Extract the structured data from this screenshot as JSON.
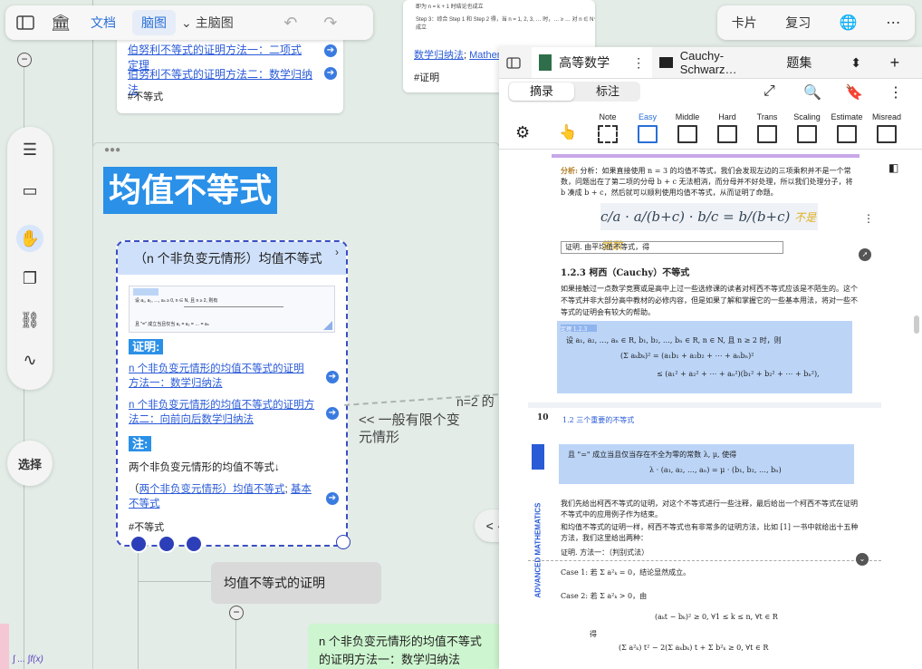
{
  "toolbar": {
    "tab_doc": "文档",
    "tab_mindmap": "脑图",
    "dropdown": "主脑图"
  },
  "topright": {
    "card": "卡片",
    "review": "复习"
  },
  "canvas": {
    "top_card": {
      "link1": "伯努利不等式的证明方法一：二项式定理",
      "link2": "伯努利不等式的证明方法二：数学归纳法",
      "tag": "#不等式"
    },
    "top_right_card": {
      "step": "Step 3：综合 Step 1 和 Step 2 得，当 n = 1, 2, 3, … 时，… ≥ … 对 n ∈ N⁺ 成立",
      "line0": "即为 n = k + 1 时结论也成立",
      "links": [
        "数学归纳法",
        "Mathem"
      ],
      "tag": "#证明"
    },
    "group_title": "均值不等式",
    "main_card": {
      "title": "（n 个非负变元情形）均值不等式",
      "thumb_caption": "设 a₁, a₂, …, aₙ ≥ 0, n ∈ N, 且 n ≥ 2, 则有",
      "thumb_note": "且 \"=\" 成立当且仅当 a₁ = a₂ = … = aₙ",
      "proof_label": "证明:",
      "link1": "n 个非负变元情形的均值不等式的证明方法一：数学归纳法",
      "link2": "n 个非负变元情形的均值不等式的证明方法二：向前向后数学归纳法",
      "note_label": "注:",
      "note_text": "两个非负变元情形的均值不等式↓",
      "link3a": "两个非负变元情形）均值不等式",
      "link3b": "基本不等式",
      "tag": "#不等式"
    },
    "edge_label1": "<< 一般有限个变元情形",
    "edge_label2": "n=2 的",
    "proof_node": "均值不等式的证明",
    "green_node": "n 个非负变元情形的均值不等式的证明方法一：数学归纳法",
    "nav": "< · >"
  },
  "left_tools": {
    "select": "选择"
  },
  "panel": {
    "tab1": "高等数学",
    "tab2": "Cauchy-Schwarz…",
    "tab3": "题集",
    "seg_excerpt": "摘录",
    "seg_annotate": "标注",
    "tools": [
      "Note",
      "Easy",
      "Middle",
      "Hard",
      "Trans",
      "Scaling",
      "Estimate",
      "Misread"
    ],
    "doc": {
      "analysis": "分析：如果直接使用 n = 3 的均值不等式，我们会发现左边的三项乘积并不是一个常数，问题出在了第二项的分母 b + c 无法相消，而分母并不好处理，所以我们处理分子，将 b 凑成 b + c，然后就可以顺利使用均值不等式，从而证明了命题。",
      "handwritten": "不是常数",
      "proof_line": "证明.  由平均值不等式，得",
      "section": "1.2.3  柯西（Cauchy）不等式",
      "intro": "如果接触过一点数学竞赛或是高中上过一些选修课的读者对柯西不等式应该是不陌生的。这个不等式并非大部分高中教材的必修内容，但是如果了解和掌握它的一些基本用法，将对一些不等式的证明会有较大的帮助。",
      "thm_label": "定理 1.2.3",
      "thm": "设 a₁, a₂, …, aₙ ∈ R, b₁, b₂, …, bₙ ∈ R, n ∈ N, 且 n ≥ 2 时，则",
      "page_no": "10",
      "page_head": "1.2  三个重要的不等式",
      "side_text": "ADVANCED MATHEMATICS",
      "cond": "且 \"=\" 成立当且仅当存在不全为零的常数 λ, μ, 使得",
      "cond_eq": "λ · (a₁, a₂, …, aₙ) = μ · (b₁, b₂, …, bₙ)",
      "p1": "我们先给出柯西不等式的证明，对这个不等式进行一些注释，最后给出一个柯西不等式在证明不等式中的应用例子作为结束。",
      "p2": "和均值不等式的证明一样，柯西不等式也有非常多的证明方法，比如 [1] 一书中就给出十五种方法，我们这里给出两种：",
      "method": "证明.  方法一：（判别式法）",
      "case1": "Case 1: 若 Σ a²ₖ = 0，结论显然成立。",
      "case2": "Case 2: 若 Σ a²ₖ > 0，由",
      "eq_a": "(aₖt − bₖ)² ≥ 0,   ∀1 ≤ k ≤ n,   ∀t ∈ R",
      "de": "得",
      "eq_b": "(Σ a²ₖ) t² − 2(Σ aₖbₖ) t + Σ b²ₖ ≥ 0,   ∀t ∈ R"
    }
  }
}
